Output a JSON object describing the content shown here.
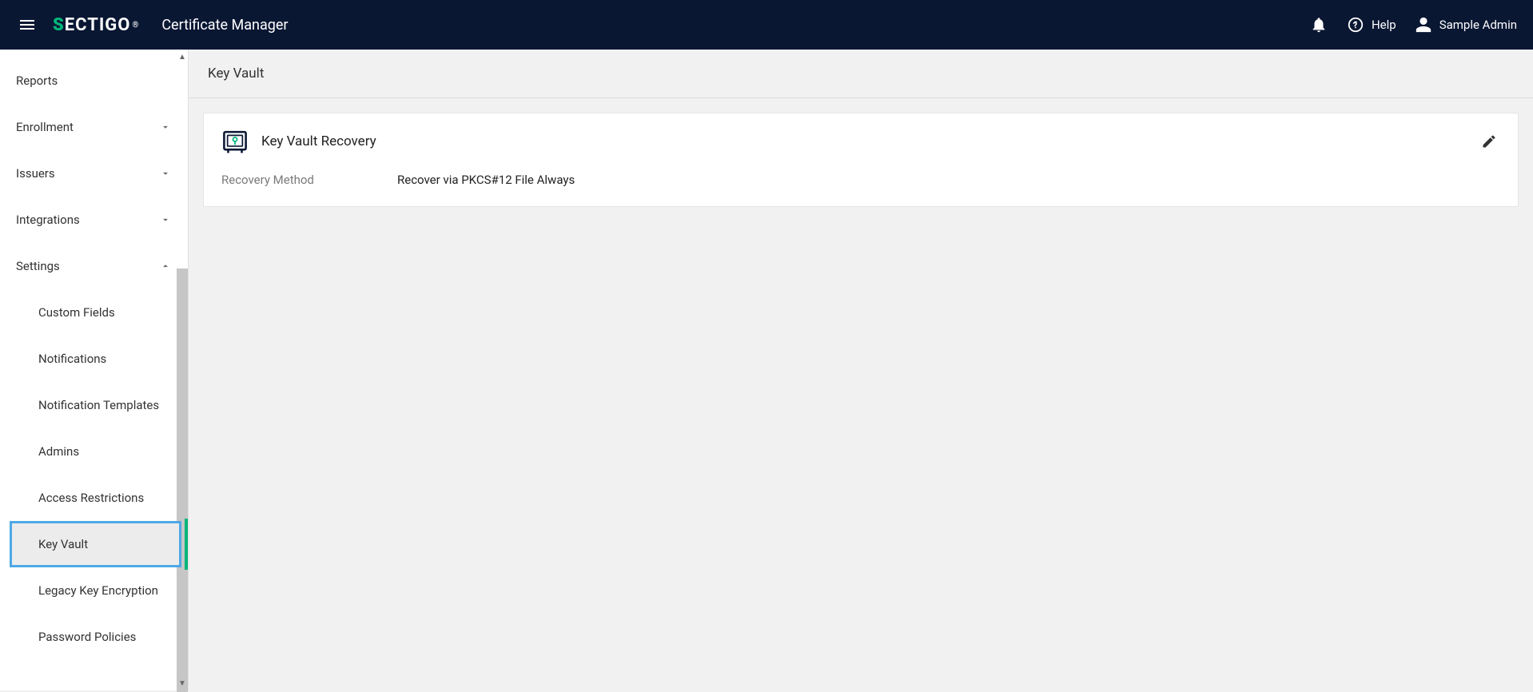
{
  "header": {
    "logo_text_pre": "S",
    "logo_text_main": "ECTIGO",
    "logo_trademark": "®",
    "app_title": "Certificate Manager",
    "help_label": "Help",
    "user_name": "Sample Admin"
  },
  "sidebar": {
    "items": [
      {
        "label": "Reports",
        "expandable": false
      },
      {
        "label": "Enrollment",
        "expandable": true,
        "expanded": false
      },
      {
        "label": "Issuers",
        "expandable": true,
        "expanded": false
      },
      {
        "label": "Integrations",
        "expandable": true,
        "expanded": false
      },
      {
        "label": "Settings",
        "expandable": true,
        "expanded": true
      }
    ],
    "settings_sub": [
      {
        "label": "Custom Fields",
        "active": false
      },
      {
        "label": "Notifications",
        "active": false
      },
      {
        "label": "Notification Templates",
        "active": false
      },
      {
        "label": "Admins",
        "active": false
      },
      {
        "label": "Access Restrictions",
        "active": false
      },
      {
        "label": "Key Vault",
        "active": true
      },
      {
        "label": "Legacy Key Encryption",
        "active": false
      },
      {
        "label": "Password Policies",
        "active": false
      }
    ]
  },
  "page": {
    "title": "Key Vault",
    "card": {
      "title": "Key Vault Recovery",
      "recovery_method_label": "Recovery Method",
      "recovery_method_value": "Recover via PKCS#12 File Always"
    }
  }
}
